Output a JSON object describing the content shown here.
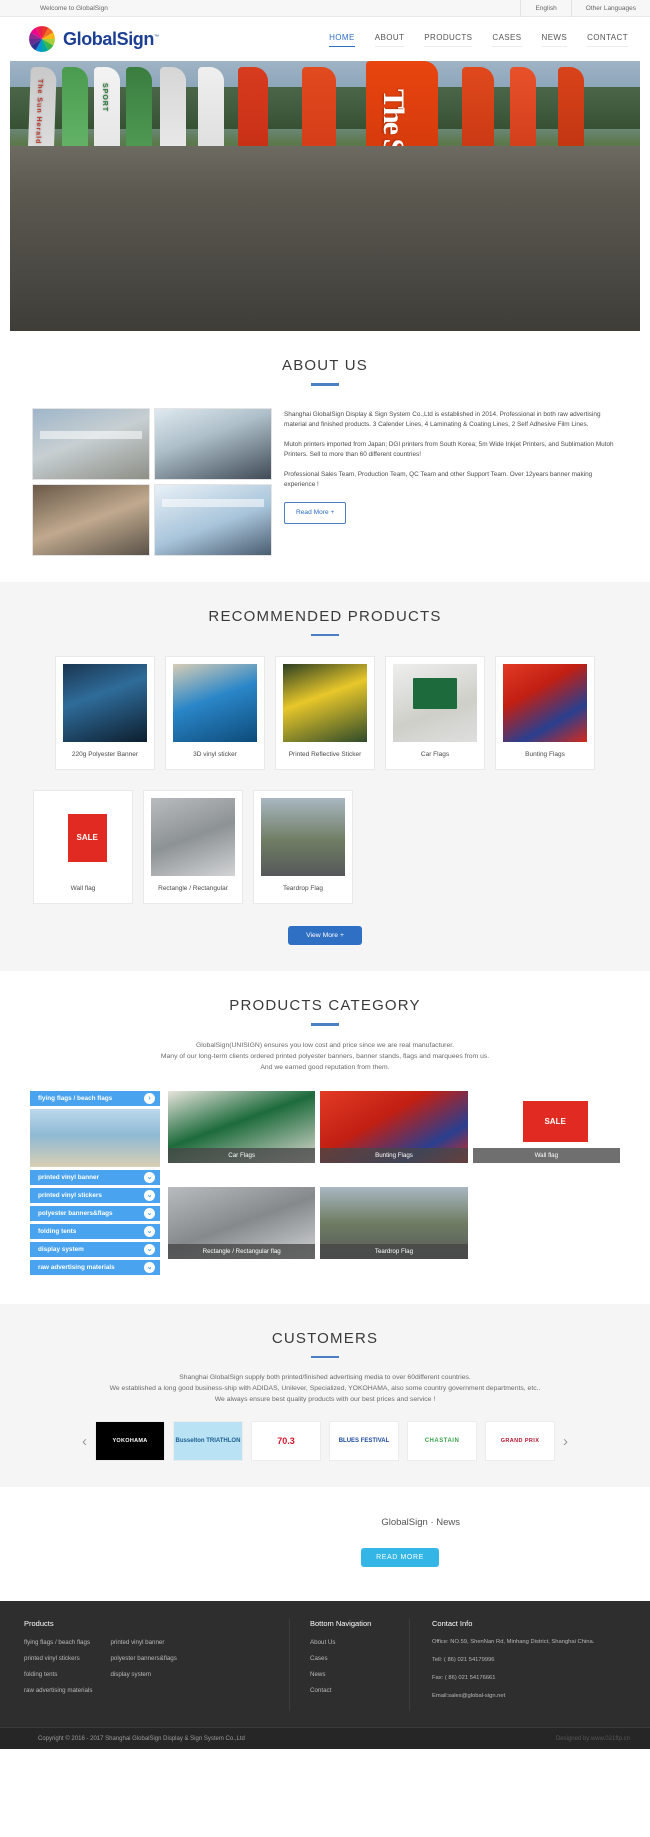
{
  "topbar": {
    "welcome": "Welcome to GlobalSign",
    "lang_primary": "English",
    "lang_other": "Other Languages"
  },
  "header": {
    "brand": "GlobalSign",
    "brand_tm": "™",
    "nav": [
      {
        "label": "HOME",
        "active": true
      },
      {
        "label": "ABOUT",
        "active": false
      },
      {
        "label": "PRODUCTS",
        "active": false
      },
      {
        "label": "CASES",
        "active": false
      },
      {
        "label": "NEWS",
        "active": false
      },
      {
        "label": "CONTACT",
        "active": false
      }
    ]
  },
  "hero": {
    "banner_text_1": "The Sun Herald",
    "banner_text_2": "SPORT",
    "banner_big": "The Sun"
  },
  "about": {
    "title": "ABOUT US",
    "p1": "Shanghai GlobalSign Display & Sign System Co.,Ltd is established in 2014. Professional in both raw advertising material and finished products. 3 Calender Lines, 4 Laminating & Coating Lines, 2 Self Adhesive Film Lines.",
    "p2": "Mutoh printers imported from Japan; DGI printers from South Korea; 5m Wide Inkjet Printers, and Sublimation Mutoh Printers. Sell to more than 60 different countries!",
    "p3": "Professional Sales Team, Production Team, QC Team and other Support Team. Over 12years banner making experience !",
    "read_more": "Read More +"
  },
  "recommended": {
    "title": "RECOMMENDED PRODUCTS",
    "view_more": "View More +",
    "row1": [
      {
        "name": "220g Polyester Banner"
      },
      {
        "name": "3D vinyl sticker"
      },
      {
        "name": "Printed Reflective Sticker"
      },
      {
        "name": "Car Flags"
      },
      {
        "name": "Bunting Flags"
      }
    ],
    "row2": [
      {
        "name": "Wall flag"
      },
      {
        "name": "Rectangle / Rectangular"
      },
      {
        "name": "Teardrop Flag"
      }
    ]
  },
  "category": {
    "title": "PRODUCTS CATEGORY",
    "sub1": "GlobalSign(UNISIGN) ensures you low cost and price since we are real manufacturer.",
    "sub2": "Many of our long-term clients ordered printed polyester banners, banner stands, flags and marquees from us.",
    "sub3": "And we earned good reputation from them.",
    "items": [
      {
        "label": "flying flags / beach flags",
        "icon": "chevron-right-icon"
      },
      {
        "label": "printed vinyl banner",
        "icon": "chevron-down-icon"
      },
      {
        "label": "printed vinyl stickers",
        "icon": "chevron-down-icon"
      },
      {
        "label": "polyester banners&flags",
        "icon": "chevron-down-icon"
      },
      {
        "label": "folding tents",
        "icon": "chevron-down-icon"
      },
      {
        "label": "display system",
        "icon": "chevron-down-icon"
      },
      {
        "label": "raw advertising materials",
        "icon": "chevron-down-icon"
      }
    ],
    "tiles": [
      {
        "caption": "Car Flags"
      },
      {
        "caption": "Bunting Flags"
      },
      {
        "caption": "Wall flag"
      },
      {
        "caption": "Rectangle / Rectangular flag"
      },
      {
        "caption": "Teardrop Flag"
      }
    ]
  },
  "customers": {
    "title": "CUSTOMERS",
    "sub1": "Shanghai GlobalSign supply both printed/finished advertising media to over 60different countries.",
    "sub2": "We established a long good business-ship with ADIDAS, Unilever, Specialized, YOKOHAMA, also some country government departments, etc..",
    "sub3": "We always ensure best quality products with our best prices and service !",
    "logos": [
      {
        "name": "YOKOHAMA"
      },
      {
        "name": "Busselton TRIATHLON"
      },
      {
        "name": "70.3"
      },
      {
        "name": "BLUES FESTIVAL"
      },
      {
        "name": "CHASTAIN"
      },
      {
        "name": "GRAND PRIX"
      }
    ],
    "prev_icon": "chevron-left-icon",
    "next_icon": "chevron-right-icon"
  },
  "news": {
    "title": "GlobalSign · News",
    "read_more": "READ MORE"
  },
  "footer": {
    "products_title": "Products",
    "products_col1": [
      "flying flags / beach flags",
      "printed vinyl stickers",
      "folding tents",
      "raw advertising materials"
    ],
    "products_col2": [
      "printed vinyl banner",
      "polyester banners&flags",
      "display system"
    ],
    "nav_title": "Bottom Navigation",
    "nav_items": [
      "About Us",
      "Cases",
      "News",
      "Contact"
    ],
    "contact_title": "Contact Info",
    "contact_lines": [
      "Office: NO.59, ShenNan Rd, Minhang District, Shanghai China.",
      "Tell: ( 86) 021 54179996",
      "Fax: ( 86) 021 54176661",
      "Email:sales@global-sign.net"
    ],
    "copyright": "Copyright © 2016 - 2017 Shanghai GlobalSign Display & Sign System Co.,Ltd",
    "designed_by": "Designed by:www.021ftp.cn"
  },
  "colors": {
    "brand_blue": "#1c3f94",
    "accent_blue": "#2f6fc4",
    "category_blue": "#49a3ef",
    "news_blue": "#33b5e5",
    "footer_dark": "#2e2e2e"
  }
}
